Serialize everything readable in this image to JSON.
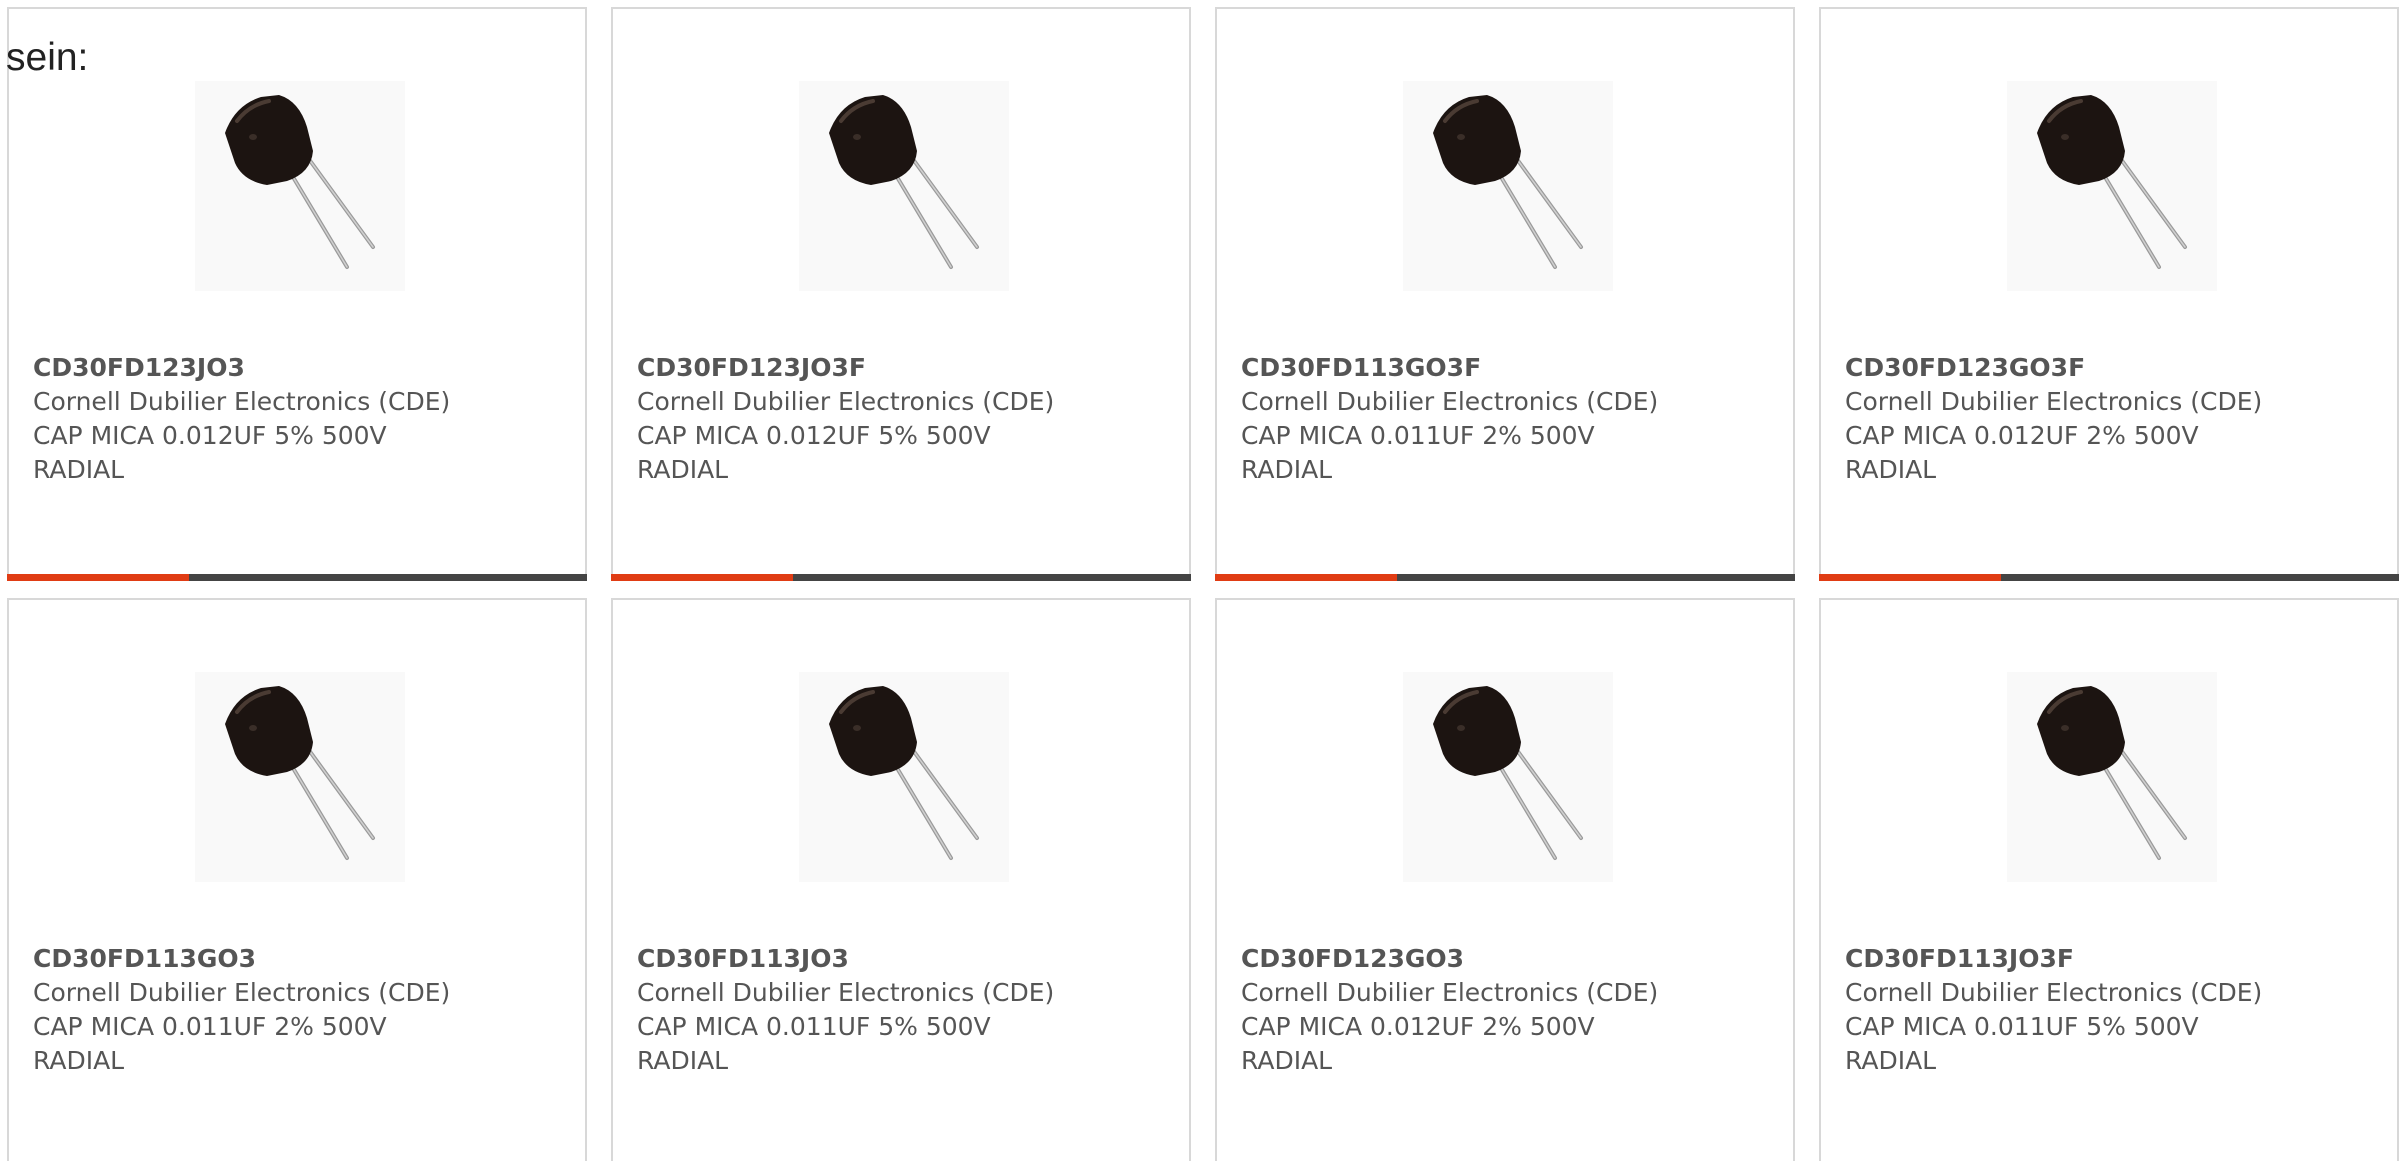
{
  "intro_text": "sein:",
  "colors": {
    "accent": "#e03c14",
    "bar": "#444444",
    "text": "#555555"
  },
  "products": [
    {
      "part_number": "CD30FD123JO3",
      "manufacturer": "Cornell Dubilier Electronics (CDE)",
      "desc_line1": "CAP MICA 0.012UF 5% 500V",
      "desc_line2": "RADIAL",
      "image_icon": "mica-capacitor-image"
    },
    {
      "part_number": "CD30FD123JO3F",
      "manufacturer": "Cornell Dubilier Electronics (CDE)",
      "desc_line1": "CAP MICA 0.012UF 5% 500V",
      "desc_line2": "RADIAL",
      "image_icon": "mica-capacitor-image"
    },
    {
      "part_number": "CD30FD113GO3F",
      "manufacturer": "Cornell Dubilier Electronics (CDE)",
      "desc_line1": "CAP MICA 0.011UF 2% 500V",
      "desc_line2": "RADIAL",
      "image_icon": "mica-capacitor-image"
    },
    {
      "part_number": "CD30FD123GO3F",
      "manufacturer": "Cornell Dubilier Electronics (CDE)",
      "desc_line1": "CAP MICA 0.012UF 2% 500V",
      "desc_line2": "RADIAL",
      "image_icon": "mica-capacitor-image"
    },
    {
      "part_number": "CD30FD113GO3",
      "manufacturer": "Cornell Dubilier Electronics (CDE)",
      "desc_line1": "CAP MICA 0.011UF 2% 500V",
      "desc_line2": "RADIAL",
      "image_icon": "mica-capacitor-image"
    },
    {
      "part_number": "CD30FD113JO3",
      "manufacturer": "Cornell Dubilier Electronics (CDE)",
      "desc_line1": "CAP MICA 0.011UF 5% 500V",
      "desc_line2": "RADIAL",
      "image_icon": "mica-capacitor-image"
    },
    {
      "part_number": "CD30FD123GO3",
      "manufacturer": "Cornell Dubilier Electronics (CDE)",
      "desc_line1": "CAP MICA 0.012UF 2% 500V",
      "desc_line2": "RADIAL",
      "image_icon": "mica-capacitor-image"
    },
    {
      "part_number": "CD30FD113JO3F",
      "manufacturer": "Cornell Dubilier Electronics (CDE)",
      "desc_line1": "CAP MICA 0.011UF 5% 500V",
      "desc_line2": "RADIAL",
      "image_icon": "mica-capacitor-image"
    }
  ]
}
